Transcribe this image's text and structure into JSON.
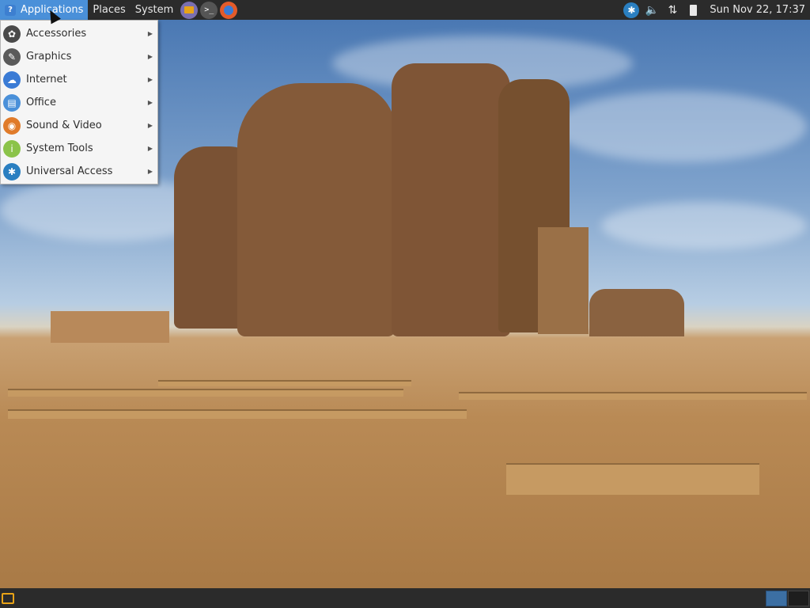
{
  "top_panel": {
    "menus": [
      "Applications",
      "Places",
      "System"
    ],
    "launchers": [
      {
        "name": "file-manager-icon",
        "color": "#e8a317"
      },
      {
        "name": "terminal-icon",
        "color": "#555555"
      },
      {
        "name": "firefox-icon",
        "color": "#e35b2a"
      }
    ],
    "clock": "Sun Nov 22, 17:37"
  },
  "app_menu": {
    "items": [
      {
        "label": "Accessories",
        "icon": "accessories-icon",
        "color": "#4a4a4a"
      },
      {
        "label": "Graphics",
        "icon": "graphics-icon",
        "color": "#5a5a5a"
      },
      {
        "label": "Internet",
        "icon": "internet-icon",
        "color": "#3a7bd5"
      },
      {
        "label": "Office",
        "icon": "office-icon",
        "color": "#4a90d9"
      },
      {
        "label": "Sound & Video",
        "icon": "sound-video-icon",
        "color": "#e07b2a"
      },
      {
        "label": "System Tools",
        "icon": "system-tools-icon",
        "color": "#8bc34a"
      },
      {
        "label": "Universal Access",
        "icon": "universal-access-icon",
        "color": "#2a7fc1"
      }
    ]
  },
  "colors": {
    "panel_bg": "#2b2b2b",
    "accent": "#4a90d9",
    "menu_bg": "#f5f5f5"
  }
}
